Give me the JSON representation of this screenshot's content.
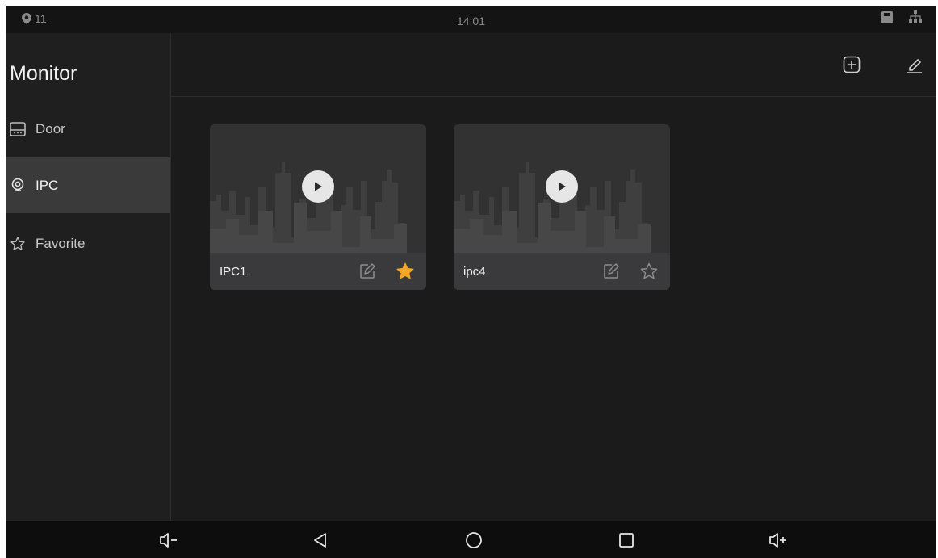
{
  "status_bar": {
    "notification_count": "11",
    "time": "14:01"
  },
  "sidebar": {
    "title": "Monitor",
    "items": [
      {
        "label": "Door",
        "icon": "door-station-icon"
      },
      {
        "label": "IPC",
        "icon": "camera-icon",
        "active": true
      },
      {
        "label": "Favorite",
        "icon": "star-outline-icon"
      }
    ]
  },
  "header": {
    "add_icon": "add-square-icon",
    "edit_icon": "pencil-icon"
  },
  "devices": [
    {
      "name": "IPC1",
      "favorite": true
    },
    {
      "name": "ipc4",
      "favorite": false
    }
  ],
  "colors": {
    "background": "#1b1b1b",
    "active_item": "#3a3a3a",
    "favorite_star": "#f5a623",
    "card_footer": "#3a3a3c"
  }
}
